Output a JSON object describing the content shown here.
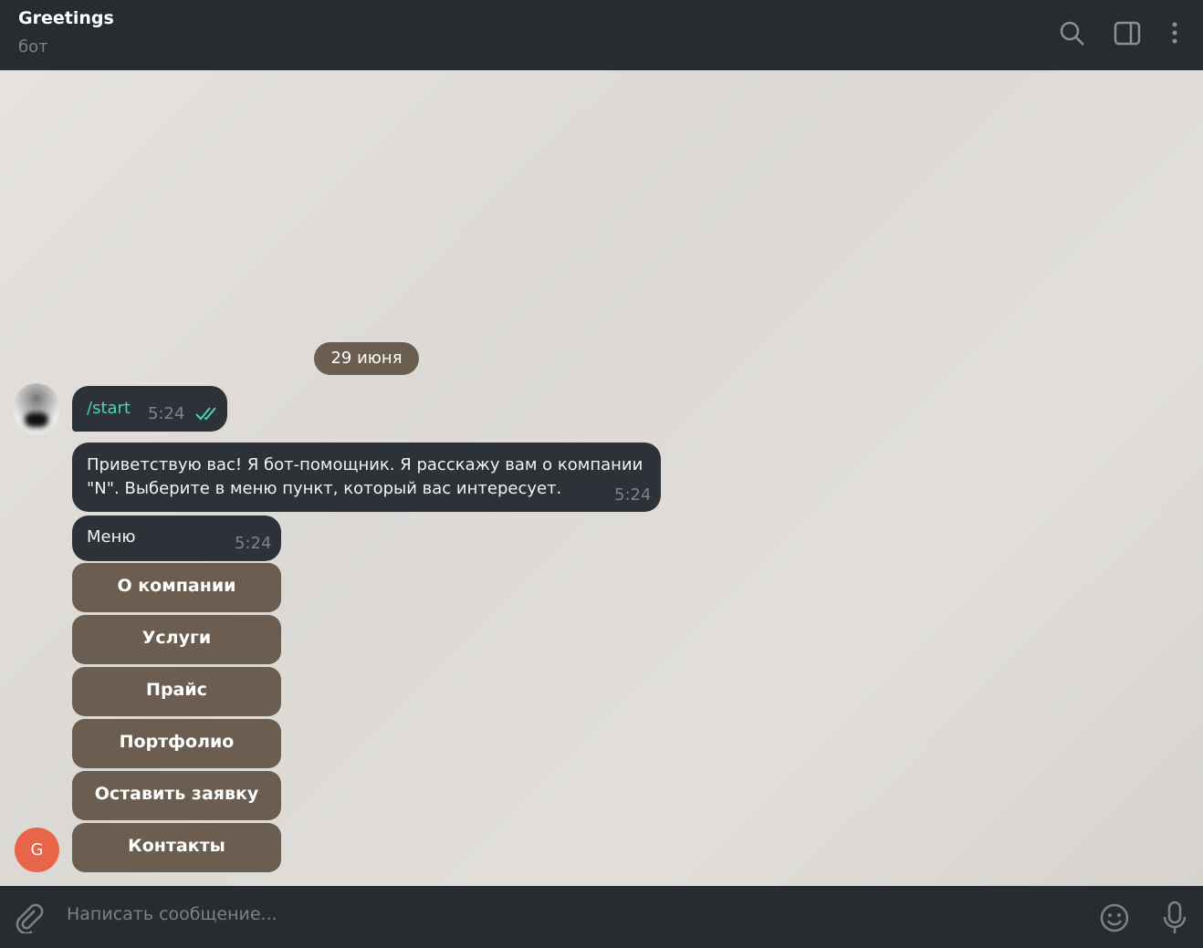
{
  "header": {
    "title": "Greetings",
    "subtitle": "бот"
  },
  "date_label": "29 июня",
  "messages": [
    {
      "text": "/start",
      "time": "5:24"
    },
    {
      "line1": "Приветствую вас! Я бот-помощник. Я расскажу вам о компании",
      "line2": "\"N\". Выберите в меню пункт, который вас интересует.",
      "time": "5:24"
    },
    {
      "text": "Меню",
      "time": "5:24"
    }
  ],
  "buttons": [
    "О компании",
    "Услуги",
    "Прайс",
    "Портфолио",
    "Оставить заявку",
    "Контакты"
  ],
  "user_avatar_letter": "G",
  "composer": {
    "placeholder": "Написать сообщение..."
  }
}
